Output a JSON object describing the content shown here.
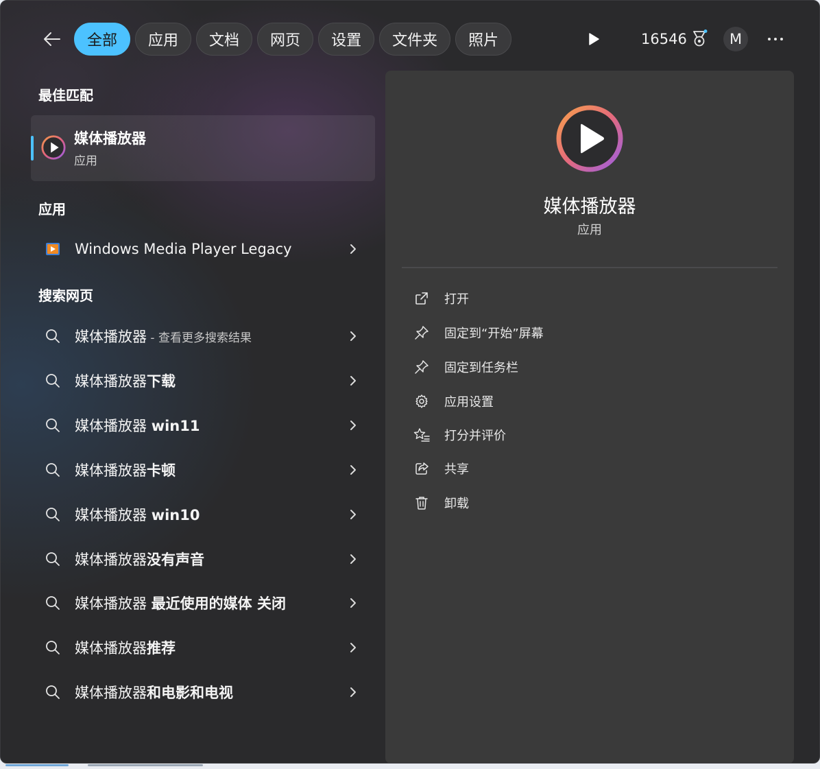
{
  "nav": {
    "back_icon": "arrow-left-icon",
    "chips": [
      {
        "label": "全部",
        "active": true
      },
      {
        "label": "应用",
        "active": false
      },
      {
        "label": "文档",
        "active": false
      },
      {
        "label": "网页",
        "active": false
      },
      {
        "label": "设置",
        "active": false
      },
      {
        "label": "文件夹",
        "active": false
      },
      {
        "label": "照片",
        "active": false
      }
    ],
    "points": "16546",
    "avatar_letter": "M",
    "accent_color": "#4cc2ff"
  },
  "best_match": {
    "title": "最佳匹配",
    "app_name": "媒体播放器",
    "app_type": "应用"
  },
  "apps": {
    "title": "应用",
    "items": [
      {
        "label": "Windows Media Player Legacy"
      }
    ]
  },
  "web": {
    "title": "搜索网页",
    "items": [
      {
        "prefix": "媒体播放器",
        "suffix": "",
        "hint": " - 查看更多搜索结果"
      },
      {
        "prefix": "媒体播放器",
        "suffix": "下载",
        "hint": ""
      },
      {
        "prefix": "媒体播放器 ",
        "suffix": "win11",
        "hint": ""
      },
      {
        "prefix": "媒体播放器",
        "suffix": "卡顿",
        "hint": ""
      },
      {
        "prefix": "媒体播放器 ",
        "suffix": "win10",
        "hint": ""
      },
      {
        "prefix": "媒体播放器",
        "suffix": "没有声音",
        "hint": ""
      },
      {
        "prefix": "媒体播放器 ",
        "suffix": "最近使用的媒体 关闭",
        "hint": ""
      },
      {
        "prefix": "媒体播放器",
        "suffix": "推荐",
        "hint": ""
      },
      {
        "prefix": "媒体播放器",
        "suffix": "和电影和电视",
        "hint": ""
      }
    ]
  },
  "detail": {
    "app_name": "媒体播放器",
    "app_type": "应用",
    "actions": [
      {
        "label": "打开",
        "icon": "open-external-icon"
      },
      {
        "label": "固定到“开始”屏幕",
        "icon": "pin-icon"
      },
      {
        "label": "固定到任务栏",
        "icon": "pin-icon"
      },
      {
        "label": "应用设置",
        "icon": "gear-icon"
      },
      {
        "label": "打分并评价",
        "icon": "star-list-icon"
      },
      {
        "label": "共享",
        "icon": "share-icon"
      },
      {
        "label": "卸载",
        "icon": "trash-icon"
      }
    ]
  }
}
